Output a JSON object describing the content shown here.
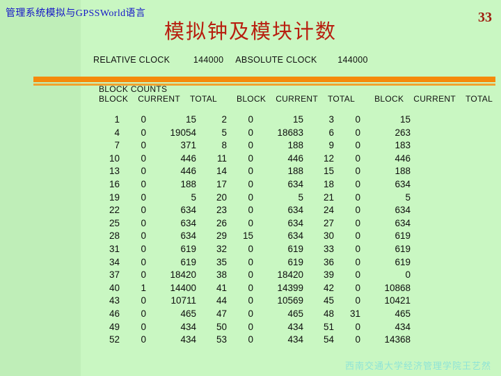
{
  "slide": {
    "kicker": "管理系统模拟与GPSSWorld语言",
    "title": "模拟钟及模块计数",
    "page_number": "33",
    "footer": "西南交通大学经济管理学院王艺然",
    "colors": {
      "background": "#c6f2c0",
      "title": "#b81f10",
      "kicker": "#1414c8",
      "rule": "#f58a0b",
      "rule_thin": "#f0a32e",
      "page_number": "#9e1b0e",
      "footer": "#8fe3d6",
      "text": "#101010"
    }
  },
  "clock": {
    "relative_label": "RELATIVE CLOCK",
    "relative_value": "144000",
    "absolute_label": "ABSOLUTE CLOCK",
    "absolute_value": "144000"
  },
  "report": {
    "section_label": "BLOCK COUNTS",
    "headers": [
      "BLOCK",
      "CURRENT",
      "TOTAL"
    ],
    "column_groups": [
      {
        "rows": [
          [
            "1",
            "0",
            "15"
          ],
          [
            "4",
            "0",
            "19054"
          ],
          [
            "7",
            "0",
            "371"
          ],
          [
            "10",
            "0",
            "446"
          ],
          [
            "13",
            "0",
            "446"
          ],
          [
            "16",
            "0",
            "188"
          ],
          [
            "19",
            "0",
            "5"
          ],
          [
            "22",
            "0",
            "634"
          ],
          [
            "25",
            "0",
            "634"
          ],
          [
            "28",
            "0",
            "634"
          ],
          [
            "31",
            "0",
            "619"
          ],
          [
            "34",
            "0",
            "619"
          ],
          [
            "37",
            "0",
            "18420"
          ],
          [
            "40",
            "1",
            "14400"
          ],
          [
            "43",
            "0",
            "10711"
          ],
          [
            "46",
            "0",
            "465"
          ],
          [
            "49",
            "0",
            "434"
          ],
          [
            "52",
            "0",
            "434"
          ]
        ]
      },
      {
        "rows": [
          [
            "2",
            "0",
            "15"
          ],
          [
            "5",
            "0",
            "18683"
          ],
          [
            "8",
            "0",
            "188"
          ],
          [
            "11",
            "0",
            "446"
          ],
          [
            "14",
            "0",
            "188"
          ],
          [
            "17",
            "0",
            "634"
          ],
          [
            "20",
            "0",
            "5"
          ],
          [
            "23",
            "0",
            "634"
          ],
          [
            "26",
            "0",
            "634"
          ],
          [
            "29",
            "15",
            "634"
          ],
          [
            "32",
            "0",
            "619"
          ],
          [
            "35",
            "0",
            "619"
          ],
          [
            "38",
            "0",
            "18420"
          ],
          [
            "41",
            "0",
            "14399"
          ],
          [
            "44",
            "0",
            "10569"
          ],
          [
            "47",
            "0",
            "465"
          ],
          [
            "50",
            "0",
            "434"
          ],
          [
            "53",
            "0",
            "434"
          ]
        ]
      },
      {
        "rows": [
          [
            "3",
            "0",
            "15"
          ],
          [
            "6",
            "0",
            "263"
          ],
          [
            "9",
            "0",
            "183"
          ],
          [
            "12",
            "0",
            "446"
          ],
          [
            "15",
            "0",
            "188"
          ],
          [
            "18",
            "0",
            "634"
          ],
          [
            "21",
            "0",
            "5"
          ],
          [
            "24",
            "0",
            "634"
          ],
          [
            "27",
            "0",
            "634"
          ],
          [
            "30",
            "0",
            "619"
          ],
          [
            "33",
            "0",
            "619"
          ],
          [
            "36",
            "0",
            "619"
          ],
          [
            "39",
            "0",
            "0"
          ],
          [
            "42",
            "0",
            "10868"
          ],
          [
            "45",
            "0",
            "10421"
          ],
          [
            "48",
            "31",
            "465"
          ],
          [
            "51",
            "0",
            "434"
          ],
          [
            "54",
            "0",
            "14368"
          ]
        ]
      }
    ]
  }
}
